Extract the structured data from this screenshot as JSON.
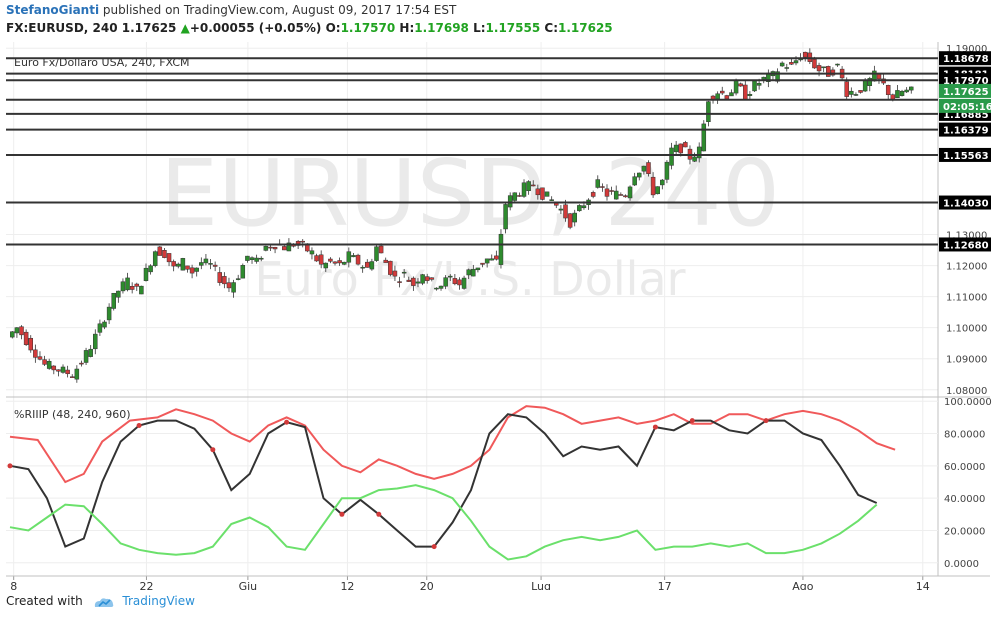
{
  "header": {
    "author": "StefanoGianti",
    "published_text": " published on TradingView.com, August 09, 2017 17:54 EST",
    "symbol": "FX:EURUSD, 240",
    "last": "1.17625",
    "change_arrow": "▲",
    "change": "+0.00055 (+0.05%)",
    "o_label": "O:",
    "o_val": "1.17570",
    "h_label": "H:",
    "h_val": "1.17698",
    "l_label": "L:",
    "l_val": "1.17555",
    "c_label": "C:",
    "c_val": "1.17625"
  },
  "footer": {
    "created_with": "Created with",
    "brand": "TradingView"
  },
  "colors": {
    "up": "#2e8b2e",
    "down": "#d23a3a",
    "line_red": "#f0595a",
    "line_green": "#6be06b",
    "line_dark": "#333333",
    "price_tag": "#2a9a4a"
  },
  "chart_data": [
    {
      "type": "candlestick",
      "title": "Euro Fx/Dollaro USA, 240, FXCM",
      "watermark_symbol": "EURUSD, 240",
      "watermark_name": "Euro Fx/U.S. Dollar",
      "x_ticks": [
        "8",
        "22",
        "Giu",
        "12",
        "20",
        "Lug",
        "17",
        "Ago",
        "14"
      ],
      "y_ticks": [
        "1.19000",
        "1.13000",
        "1.12000",
        "1.11000",
        "1.10000",
        "1.09000",
        "1.08000"
      ],
      "ylim": [
        1.078,
        1.192
      ],
      "horizontal_levels": [
        {
          "value": 1.18678,
          "label": "1.18678"
        },
        {
          "value": 1.18181,
          "label": "1.18181"
        },
        {
          "value": 1.1797,
          "label": "1.17970"
        },
        {
          "value": 1.16885,
          "label": "1.16885"
        },
        {
          "value": 1.16379,
          "label": "1.16379"
        },
        {
          "value": 1.15563,
          "label": "1.15563"
        },
        {
          "value": 1.1403,
          "label": "1.14030"
        },
        {
          "value": 1.1268,
          "label": "1.12680"
        }
      ],
      "unlabeled_levels": [
        1.1734
      ],
      "last_price": {
        "value": 1.17625,
        "label": "1.17625",
        "countdown": "02:05:16"
      },
      "x_range": [
        0,
        100
      ],
      "close_path": [
        [
          0,
          1.097
        ],
        [
          1,
          1.1
        ],
        [
          2,
          1.096
        ],
        [
          3,
          1.092
        ],
        [
          4,
          1.088
        ],
        [
          5,
          1.087
        ],
        [
          6,
          1.086
        ],
        [
          7,
          1.085
        ],
        [
          8,
          1.089
        ],
        [
          9,
          1.094
        ],
        [
          10,
          1.1
        ],
        [
          11,
          1.107
        ],
        [
          12,
          1.112
        ],
        [
          13,
          1.115
        ],
        [
          14,
          1.112
        ],
        [
          15,
          1.118
        ],
        [
          16,
          1.125
        ],
        [
          17,
          1.124
        ],
        [
          18,
          1.119
        ],
        [
          19,
          1.121
        ],
        [
          20,
          1.118
        ],
        [
          21,
          1.121
        ],
        [
          22,
          1.12
        ],
        [
          23,
          1.116
        ],
        [
          24,
          1.113
        ],
        [
          25,
          1.117
        ],
        [
          26,
          1.123
        ],
        [
          27,
          1.121
        ],
        [
          28,
          1.126
        ],
        [
          29,
          1.127
        ],
        [
          30,
          1.126
        ],
        [
          31,
          1.127
        ],
        [
          32,
          1.126
        ],
        [
          33,
          1.124
        ],
        [
          34,
          1.12
        ],
        [
          35,
          1.121
        ],
        [
          36,
          1.12
        ],
        [
          37,
          1.123
        ],
        [
          38,
          1.121
        ],
        [
          39,
          1.119
        ],
        [
          40,
          1.126
        ],
        [
          41,
          1.121
        ],
        [
          42,
          1.116
        ],
        [
          43,
          1.117
        ],
        [
          44,
          1.114
        ],
        [
          45,
          1.118
        ],
        [
          46,
          1.114
        ],
        [
          47,
          1.114
        ],
        [
          48,
          1.116
        ],
        [
          49,
          1.114
        ],
        [
          50,
          1.118
        ],
        [
          51,
          1.12
        ],
        [
          52,
          1.122
        ],
        [
          53,
          1.121
        ],
        [
          54,
          1.14
        ],
        [
          55,
          1.143
        ],
        [
          56,
          1.145
        ],
        [
          57,
          1.146
        ],
        [
          58,
          1.143
        ],
        [
          59,
          1.141
        ],
        [
          60,
          1.138
        ],
        [
          61,
          1.134
        ],
        [
          62,
          1.138
        ],
        [
          63,
          1.142
        ],
        [
          64,
          1.146
        ],
        [
          65,
          1.143
        ],
        [
          66,
          1.143
        ],
        [
          67,
          1.143
        ],
        [
          68,
          1.15
        ],
        [
          69,
          1.152
        ],
        [
          70,
          1.144
        ],
        [
          71,
          1.147
        ],
        [
          72,
          1.157
        ],
        [
          73,
          1.158
        ],
        [
          74,
          1.155
        ],
        [
          75,
          1.157
        ],
        [
          76,
          1.174
        ],
        [
          77,
          1.176
        ],
        [
          78,
          1.175
        ],
        [
          79,
          1.178
        ],
        [
          80,
          1.175
        ],
        [
          81,
          1.178
        ],
        [
          82,
          1.18
        ],
        [
          83,
          1.181
        ],
        [
          84,
          1.185
        ],
        [
          85,
          1.184
        ],
        [
          86,
          1.188
        ],
        [
          87,
          1.186
        ],
        [
          88,
          1.183
        ],
        [
          89,
          1.182
        ],
        [
          90,
          1.184
        ],
        [
          91,
          1.176
        ],
        [
          92,
          1.176
        ],
        [
          93,
          1.178
        ],
        [
          94,
          1.181
        ],
        [
          95,
          1.178
        ],
        [
          96,
          1.174
        ],
        [
          97,
          1.176
        ],
        [
          98,
          1.176
        ]
      ]
    },
    {
      "type": "line",
      "title": "%RIIIP (48, 240, 960)",
      "y_ticks": [
        "100.0000",
        "80.0000",
        "60.0000",
        "40.0000",
        "20.0000",
        "0.0000"
      ],
      "ylim": [
        -2,
        102
      ],
      "series": [
        {
          "color": "#f0595a",
          "values": [
            [
              0,
              78
            ],
            [
              3,
              76
            ],
            [
              6,
              50
            ],
            [
              8,
              55
            ],
            [
              10,
              75
            ],
            [
              13,
              88
            ],
            [
              16,
              90
            ],
            [
              18,
              95
            ],
            [
              20,
              92
            ],
            [
              22,
              88
            ],
            [
              24,
              80
            ],
            [
              26,
              75
            ],
            [
              28,
              85
            ],
            [
              30,
              90
            ],
            [
              32,
              85
            ],
            [
              34,
              70
            ],
            [
              36,
              60
            ],
            [
              38,
              56
            ],
            [
              40,
              64
            ],
            [
              42,
              60
            ],
            [
              44,
              55
            ],
            [
              46,
              52
            ],
            [
              48,
              55
            ],
            [
              50,
              60
            ],
            [
              52,
              70
            ],
            [
              54,
              90
            ],
            [
              56,
              97
            ],
            [
              58,
              96
            ],
            [
              60,
              92
            ],
            [
              62,
              86
            ],
            [
              64,
              88
            ],
            [
              66,
              90
            ],
            [
              68,
              86
            ],
            [
              70,
              88
            ],
            [
              72,
              92
            ],
            [
              74,
              86
            ],
            [
              76,
              86
            ],
            [
              78,
              92
            ],
            [
              80,
              92
            ],
            [
              82,
              88
            ],
            [
              84,
              92
            ],
            [
              86,
              94
            ],
            [
              88,
              92
            ],
            [
              90,
              88
            ],
            [
              92,
              82
            ],
            [
              94,
              74
            ],
            [
              96,
              70
            ]
          ]
        },
        {
          "color": "#333333",
          "values": [
            [
              0,
              60
            ],
            [
              2,
              58
            ],
            [
              4,
              40
            ],
            [
              6,
              10
            ],
            [
              8,
              15
            ],
            [
              10,
              50
            ],
            [
              12,
              75
            ],
            [
              14,
              85
            ],
            [
              16,
              88
            ],
            [
              18,
              88
            ],
            [
              20,
              83
            ],
            [
              22,
              70
            ],
            [
              24,
              45
            ],
            [
              26,
              55
            ],
            [
              28,
              80
            ],
            [
              30,
              87
            ],
            [
              32,
              84
            ],
            [
              34,
              40
            ],
            [
              36,
              30
            ],
            [
              38,
              39
            ],
            [
              40,
              30
            ],
            [
              42,
              20
            ],
            [
              44,
              10
            ],
            [
              46,
              10
            ],
            [
              48,
              25
            ],
            [
              50,
              45
            ],
            [
              52,
              80
            ],
            [
              54,
              92
            ],
            [
              56,
              90
            ],
            [
              58,
              80
            ],
            [
              60,
              66
            ],
            [
              62,
              72
            ],
            [
              64,
              70
            ],
            [
              66,
              72
            ],
            [
              68,
              60
            ],
            [
              70,
              84
            ],
            [
              72,
              82
            ],
            [
              74,
              88
            ],
            [
              76,
              88
            ],
            [
              78,
              82
            ],
            [
              80,
              80
            ],
            [
              82,
              88
            ],
            [
              84,
              88
            ],
            [
              86,
              80
            ],
            [
              88,
              76
            ],
            [
              90,
              60
            ],
            [
              92,
              42
            ],
            [
              94,
              37
            ]
          ]
        },
        {
          "color": "#6be06b",
          "values": [
            [
              0,
              22
            ],
            [
              2,
              20
            ],
            [
              4,
              28
            ],
            [
              6,
              36
            ],
            [
              8,
              35
            ],
            [
              10,
              24
            ],
            [
              12,
              12
            ],
            [
              14,
              8
            ],
            [
              16,
              6
            ],
            [
              18,
              5
            ],
            [
              20,
              6
            ],
            [
              22,
              10
            ],
            [
              24,
              24
            ],
            [
              26,
              28
            ],
            [
              28,
              22
            ],
            [
              30,
              10
            ],
            [
              32,
              8
            ],
            [
              34,
              24
            ],
            [
              36,
              40
            ],
            [
              38,
              40
            ],
            [
              40,
              45
            ],
            [
              42,
              46
            ],
            [
              44,
              48
            ],
            [
              46,
              45
            ],
            [
              48,
              40
            ],
            [
              50,
              26
            ],
            [
              52,
              10
            ],
            [
              54,
              2
            ],
            [
              56,
              4
            ],
            [
              58,
              10
            ],
            [
              60,
              14
            ],
            [
              62,
              16
            ],
            [
              64,
              14
            ],
            [
              66,
              16
            ],
            [
              68,
              20
            ],
            [
              70,
              8
            ],
            [
              72,
              10
            ],
            [
              74,
              10
            ],
            [
              76,
              12
            ],
            [
              78,
              10
            ],
            [
              80,
              12
            ],
            [
              82,
              6
            ],
            [
              84,
              6
            ],
            [
              86,
              8
            ],
            [
              88,
              12
            ],
            [
              90,
              18
            ],
            [
              92,
              26
            ],
            [
              94,
              36
            ]
          ]
        }
      ],
      "markers": [
        [
          0,
          60
        ],
        [
          14,
          85
        ],
        [
          22,
          70
        ],
        [
          30,
          87
        ],
        [
          36,
          30
        ],
        [
          40,
          30
        ],
        [
          46,
          10
        ],
        [
          70,
          84
        ],
        [
          74,
          88
        ],
        [
          82,
          88
        ]
      ]
    }
  ]
}
